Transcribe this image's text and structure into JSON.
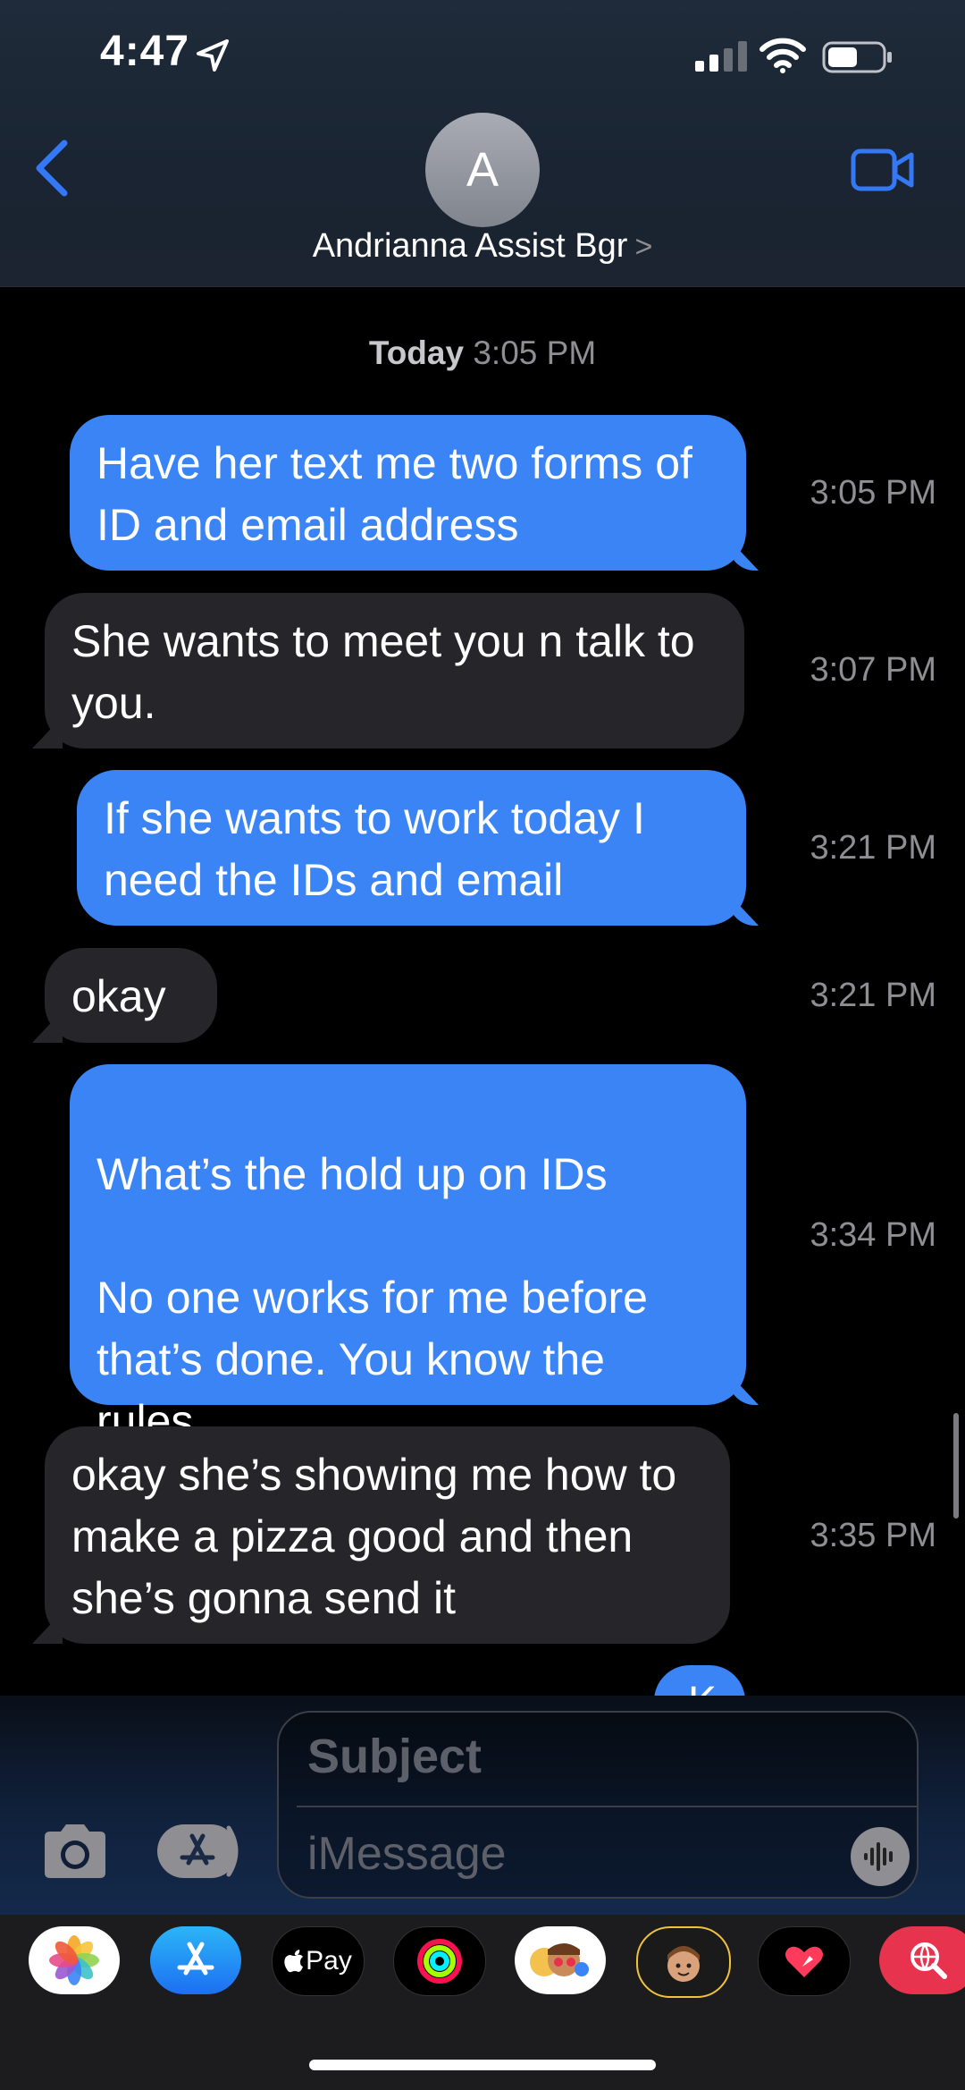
{
  "status_bar": {
    "time": "4:47"
  },
  "header": {
    "avatar_initial": "A",
    "contact_name": "Andrianna Assist Bgr"
  },
  "conversation": {
    "day_label": "Today",
    "day_time": "3:05 PM",
    "messages": [
      {
        "direction": "sent",
        "text": "Have her text me two forms of ID and email address",
        "time": "3:05 PM"
      },
      {
        "direction": "received",
        "text": "She wants to meet you n talk to you.",
        "time": "3:07 PM"
      },
      {
        "direction": "sent",
        "text": "If she wants to work today I need the IDs and email",
        "time": "3:21 PM"
      },
      {
        "direction": "received",
        "text": "okay",
        "time": "3:21 PM"
      },
      {
        "direction": "sent",
        "text": "What’s the hold up on IDs\n\nNo one works for me before that’s done. You know the rules.",
        "time": "3:34 PM"
      },
      {
        "direction": "received",
        "text": "okay she’s showing me how to make a pizza good and then she’s gonna send it",
        "time": "3:35 PM"
      },
      {
        "direction": "sent",
        "text": "K",
        "time": ""
      }
    ]
  },
  "composer": {
    "subject_placeholder": "Subject",
    "message_placeholder": "iMessage"
  },
  "app_tray": {
    "items": [
      "photos-app",
      "app-store-app",
      "apple-pay-app",
      "activity-app",
      "memoji-stickers-app",
      "memoji-app",
      "digital-touch-app",
      "web-image-search-app"
    ],
    "apple_pay_label": "Pay"
  },
  "colors": {
    "sent_bubble": "#3a84f5",
    "received_bubble": "#26262a",
    "accent": "#3478f6"
  }
}
